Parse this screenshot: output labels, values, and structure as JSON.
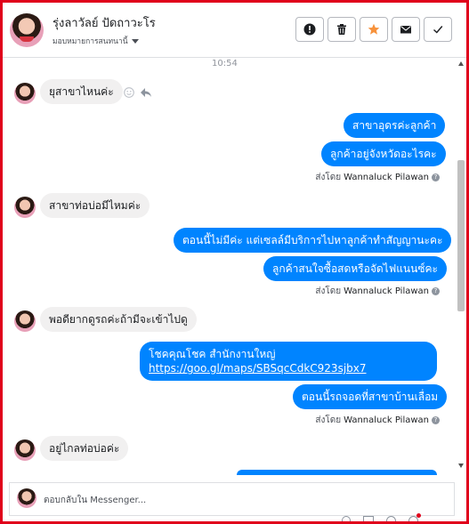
{
  "header": {
    "contact_name": "รุ่งลาวัลย์ ปัดถาวะโร",
    "assign_label": "มอบหมายการสนทนานี้",
    "actions": [
      {
        "icon": "alert-icon"
      },
      {
        "icon": "trash-icon"
      },
      {
        "icon": "star-icon",
        "color": "#f7923b"
      },
      {
        "icon": "mail-icon"
      },
      {
        "icon": "check-icon"
      }
    ]
  },
  "timestamp": "10:54",
  "messages": {
    "m1": "ยุสาขาไหนค่ะ",
    "r1a": "สาขาอุดรค่ะลูกค้า",
    "r1b": "ลูกค้าอยู่จังหวัดอะไรคะ",
    "m2": "สาขาท่อบ่อมีไหมค่ะ",
    "r2a": "ตอนนี้ไม่มีค่ะ  แต่เซลล์มีบริการไปหาลูกค้าทำสัญญานะคะ",
    "r2b": "ลูกค้าสนใจซื้อสดหรือจัดไฟแนนซ์คะ",
    "m3": "พอดียากดูรถค่ะถ้ามีจะเข้าไปดู",
    "r3a_line1": "โชคคุณโชค สำนักงานใหญ่",
    "r3a_link": "https://goo.gl/maps/SBSqcCdkC923sjbx7",
    "r3b": "ตอนนี้รถจอดที่สาขาบ้านเลื่อม",
    "m4": "อยู่ไกลท่อบ่อค่ะ"
  },
  "sent_by": {
    "prefix": "ส่งโดย",
    "name": "Wannaluck Pilawan"
  },
  "composer": {
    "placeholder": "ตอบกลับใน Messenger..."
  },
  "colors": {
    "outgoing": "#0084ff",
    "incoming": "#f1f0f0",
    "frame": "#e0001b"
  }
}
